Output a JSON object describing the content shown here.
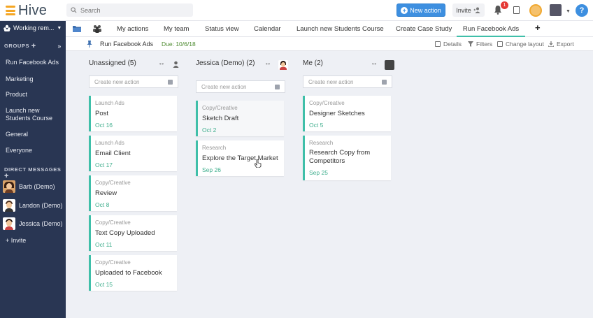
{
  "app": {
    "name": "Hive"
  },
  "search": {
    "placeholder": "Search"
  },
  "header": {
    "new_action_label": "New action",
    "invite_label": "Invite",
    "notification_count": "1",
    "help_label": "?"
  },
  "sidebar": {
    "workspace": "Working rem...",
    "groups_heading": "GROUPS",
    "groups": [
      "Run Facebook Ads",
      "Marketing",
      "Product",
      "Launch new Students Course",
      "General",
      "Everyone"
    ],
    "dm_heading": "DIRECT MESSAGES",
    "dms": [
      "Barb (Demo)",
      "Landon (Demo)",
      "Jessica (Demo)"
    ],
    "invite": "+ Invite"
  },
  "tabs": [
    "My actions",
    "My team",
    "Status view",
    "Calendar",
    "Launch new Students Course",
    "Create Case Study",
    "Run Facebook Ads"
  ],
  "active_tab": "Run Facebook Ads",
  "project": {
    "title": "Run Facebook Ads",
    "due": "Due: 10/6/18"
  },
  "toolbar": {
    "details": "Details",
    "filters": "Filters",
    "change_layout": "Change layout",
    "export": "Export"
  },
  "create_placeholder": "Create new action",
  "columns": [
    {
      "title": "Unassigned (5)",
      "cards": [
        {
          "category": "Launch Ads",
          "title": "Post",
          "date": "Oct 16"
        },
        {
          "category": "Launch Ads",
          "title": "Email Client",
          "date": "Oct 17"
        },
        {
          "category": "Copy/Creative",
          "title": "Review",
          "date": "Oct 8"
        },
        {
          "category": "Copy/Creative",
          "title": "Text Copy Uploaded",
          "date": "Oct 11"
        },
        {
          "category": "Copy/Creative",
          "title": "Uploaded to Facebook",
          "date": "Oct 15"
        }
      ]
    },
    {
      "title": "Jessica (Demo) (2)",
      "cards": [
        {
          "category": "Copy/Creative",
          "title": "Sketch Draft",
          "date": "Oct 2"
        },
        {
          "category": "Research",
          "title": "Explore the Target Market",
          "date": "Sep 26"
        }
      ]
    },
    {
      "title": "Me (2)",
      "cards": [
        {
          "category": "Copy/Creative",
          "title": "Designer Sketches",
          "date": "Oct 5"
        },
        {
          "category": "Research",
          "title": "Research Copy from Competitors",
          "date": "Sep 25"
        }
      ]
    }
  ],
  "colors": {
    "accent": "#3fbfa9",
    "sidebar": "#293653",
    "primary_button": "#3d8fe0",
    "due_green": "#4c8a2f"
  }
}
